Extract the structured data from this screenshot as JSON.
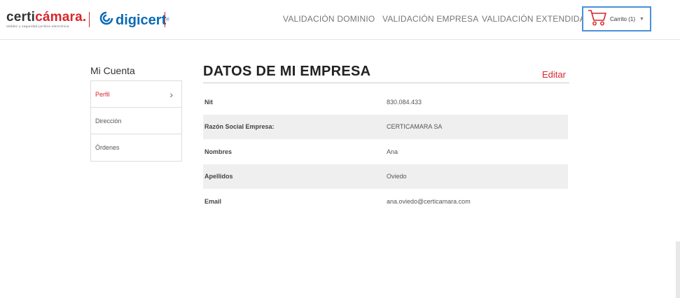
{
  "header": {
    "logo_certi_prefix": "certi",
    "logo_certi_highlight": "cámara.",
    "logo_certi_tagline": "Validez y seguridad jurídica electrónica",
    "logo_digi": "digicert",
    "logo_digi_mark": "®",
    "nav": [
      {
        "label": "VALIDACIÓN DOMINIO"
      },
      {
        "label": "VALIDACIÓN EMPRESA"
      },
      {
        "label": "VALIDACIÓN EXTENDIDA"
      }
    ],
    "cart_label": "Carrito (1)",
    "cart_caret": "▼"
  },
  "sidebar": {
    "title": "Mi Cuenta",
    "items": [
      {
        "label": "Perfil",
        "chevron": "›"
      },
      {
        "label": "Dirección"
      },
      {
        "label": "Órdenes"
      }
    ]
  },
  "main": {
    "title": "DATOS DE MI EMPRESA",
    "edit_label": "Editar",
    "rows": [
      {
        "key": "Nit",
        "value": "830.084.433"
      },
      {
        "key": "Razón Social Empresa:",
        "value": "CERTICAMARA SA"
      },
      {
        "key": "Nombres",
        "value": "Ana"
      },
      {
        "key": "Apellidos",
        "value": "Oviedo"
      },
      {
        "key": "Email",
        "value": "ana.oviedo@certicamara.com"
      }
    ]
  },
  "colors": {
    "brand_red": "#d7262d",
    "digicert_blue": "#0a6bb5",
    "cart_border": "#4a90d9"
  },
  "icons": {
    "cart": "cart-icon",
    "digicert": "digicert-logo-icon"
  }
}
